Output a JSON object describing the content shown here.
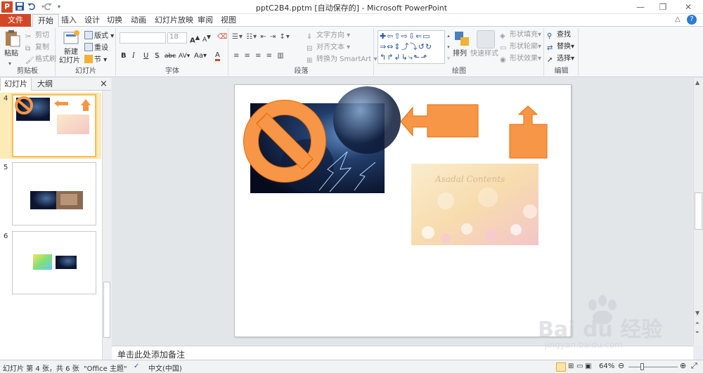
{
  "window": {
    "title": "pptC2B4.pptm [自动保存的] - Microsoft PowerPoint",
    "app_icon": "P",
    "quick_access": [
      "save-icon",
      "undo-icon",
      "redo-icon"
    ]
  },
  "tabs": {
    "file": "文件",
    "items": [
      "开始",
      "插入",
      "设计",
      "切换",
      "动画",
      "幻灯片放映",
      "审阅",
      "视图"
    ],
    "active": "开始"
  },
  "ribbon": {
    "clipboard": {
      "label": "剪贴板",
      "paste": "粘贴",
      "cut": "剪切",
      "copy": "复制",
      "format_painter": "格式刷"
    },
    "slides": {
      "label": "幻灯片",
      "new_slide": "新建",
      "new_slide_2": "幻灯片",
      "layout": "版式",
      "reset": "重设",
      "section": "节"
    },
    "font": {
      "label": "字体",
      "font_name": "",
      "font_size": "18",
      "bold": "B",
      "italic": "I",
      "underline": "U",
      "shadow": "S",
      "strike": "abc",
      "spacing": "AV",
      "case": "Aa",
      "grow": "A",
      "shrink": "A",
      "clear": "A"
    },
    "paragraph": {
      "label": "段落",
      "text_direction": "文字方向",
      "align_text": "对齐文本",
      "smartart": "转换为 SmartArt"
    },
    "drawing": {
      "label": "绘图",
      "arrange": "排列",
      "quick_styles": "快速样式",
      "shape_fill": "形状填充",
      "shape_outline": "形状轮廓",
      "shape_effects": "形状效果"
    },
    "editing": {
      "label": "编辑",
      "find": "查找",
      "replace": "替换",
      "select": "选择"
    }
  },
  "side_panel": {
    "tabs": [
      "幻灯片",
      "大纲"
    ],
    "active_tab": "幻灯片",
    "close": "×",
    "thumbnails": [
      {
        "number": "4",
        "selected": true
      },
      {
        "number": "5",
        "selected": false
      },
      {
        "number": "6",
        "selected": false
      }
    ]
  },
  "slide": {
    "background_image_text": "Asadal Contents",
    "shape_color": "#f79646",
    "shape_border": "#e46c0a"
  },
  "notes": {
    "placeholder": "单击此处添加备注"
  },
  "status": {
    "slide_info": "幻灯片 第 4 张，共 6 张",
    "theme": "\"Office 主题\"",
    "language": "中文(中国)",
    "zoom": "64%"
  },
  "watermark": {
    "brand": "Bai du 经验",
    "url": "jingyan.baidu.com"
  }
}
